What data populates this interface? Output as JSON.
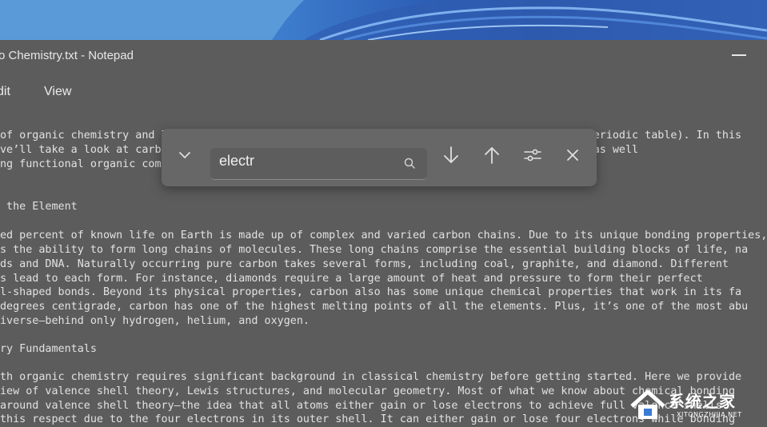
{
  "window": {
    "title": "o Chemistry.txt - Notepad"
  },
  "menu": {
    "edit": "dit",
    "view": "View"
  },
  "document": {
    "lines": [
      "of organic chemistry and life on Earth is rooted in the element carbon (listed as C on the periodic table). In this",
      "ve’ll take a look at carb                                              ng carbon compounds, as well",
      "ng functional organic com                                             amming and some handy",
      "",
      " the Element",
      "",
      "ed percent of known life on Earth is made up of complex and varied carbon chains. Due to its unique bonding properties,",
      "s the ability to form long chains of molecules. These long chains comprise the essential building blocks of life, na",
      "ds and DNA. Naturally occurring pure carbon takes several forms, including coal, graphite, and diamond. Different",
      "s lead to each form. For instance, diamonds require a large amount of heat and pressure to form their perfect",
      "l-shaped bonds. Beyond its physical properties, carbon also has some unique chemical properties that work in its fa",
      "degrees centigrade, carbon has one of the highest melting points of all the elements. Plus, it’s one of the most abu",
      "iverse—behind only hydrogen, helium, and oxygen.",
      "",
      "ry Fundamentals",
      "",
      "th organic chemistry requires significant background in classical chemistry before getting started. Here we provide",
      "iew of valence shell theory, Lewis structures, and molecular geometry. Most of what we know about chemical bonding",
      "around valence shell theory—the idea that all atoms either gain or lose electrons to achieve full valence shells.",
      "this respect due to the four electrons in its outer shell. It can either gain or lose four electrons while bonding"
    ]
  },
  "find": {
    "query": "electr",
    "icons": [
      "chevron-down-icon",
      "search-icon",
      "arrow-down-icon",
      "arrow-up-icon",
      "options-icon",
      "close-icon"
    ]
  },
  "watermark": {
    "name": "系统之家",
    "url": "XITONGZHIJIA.NET"
  },
  "colors": {
    "dim_overlay": "#575757",
    "text": "#e2e2e2",
    "findbar_bg": "#676767"
  }
}
